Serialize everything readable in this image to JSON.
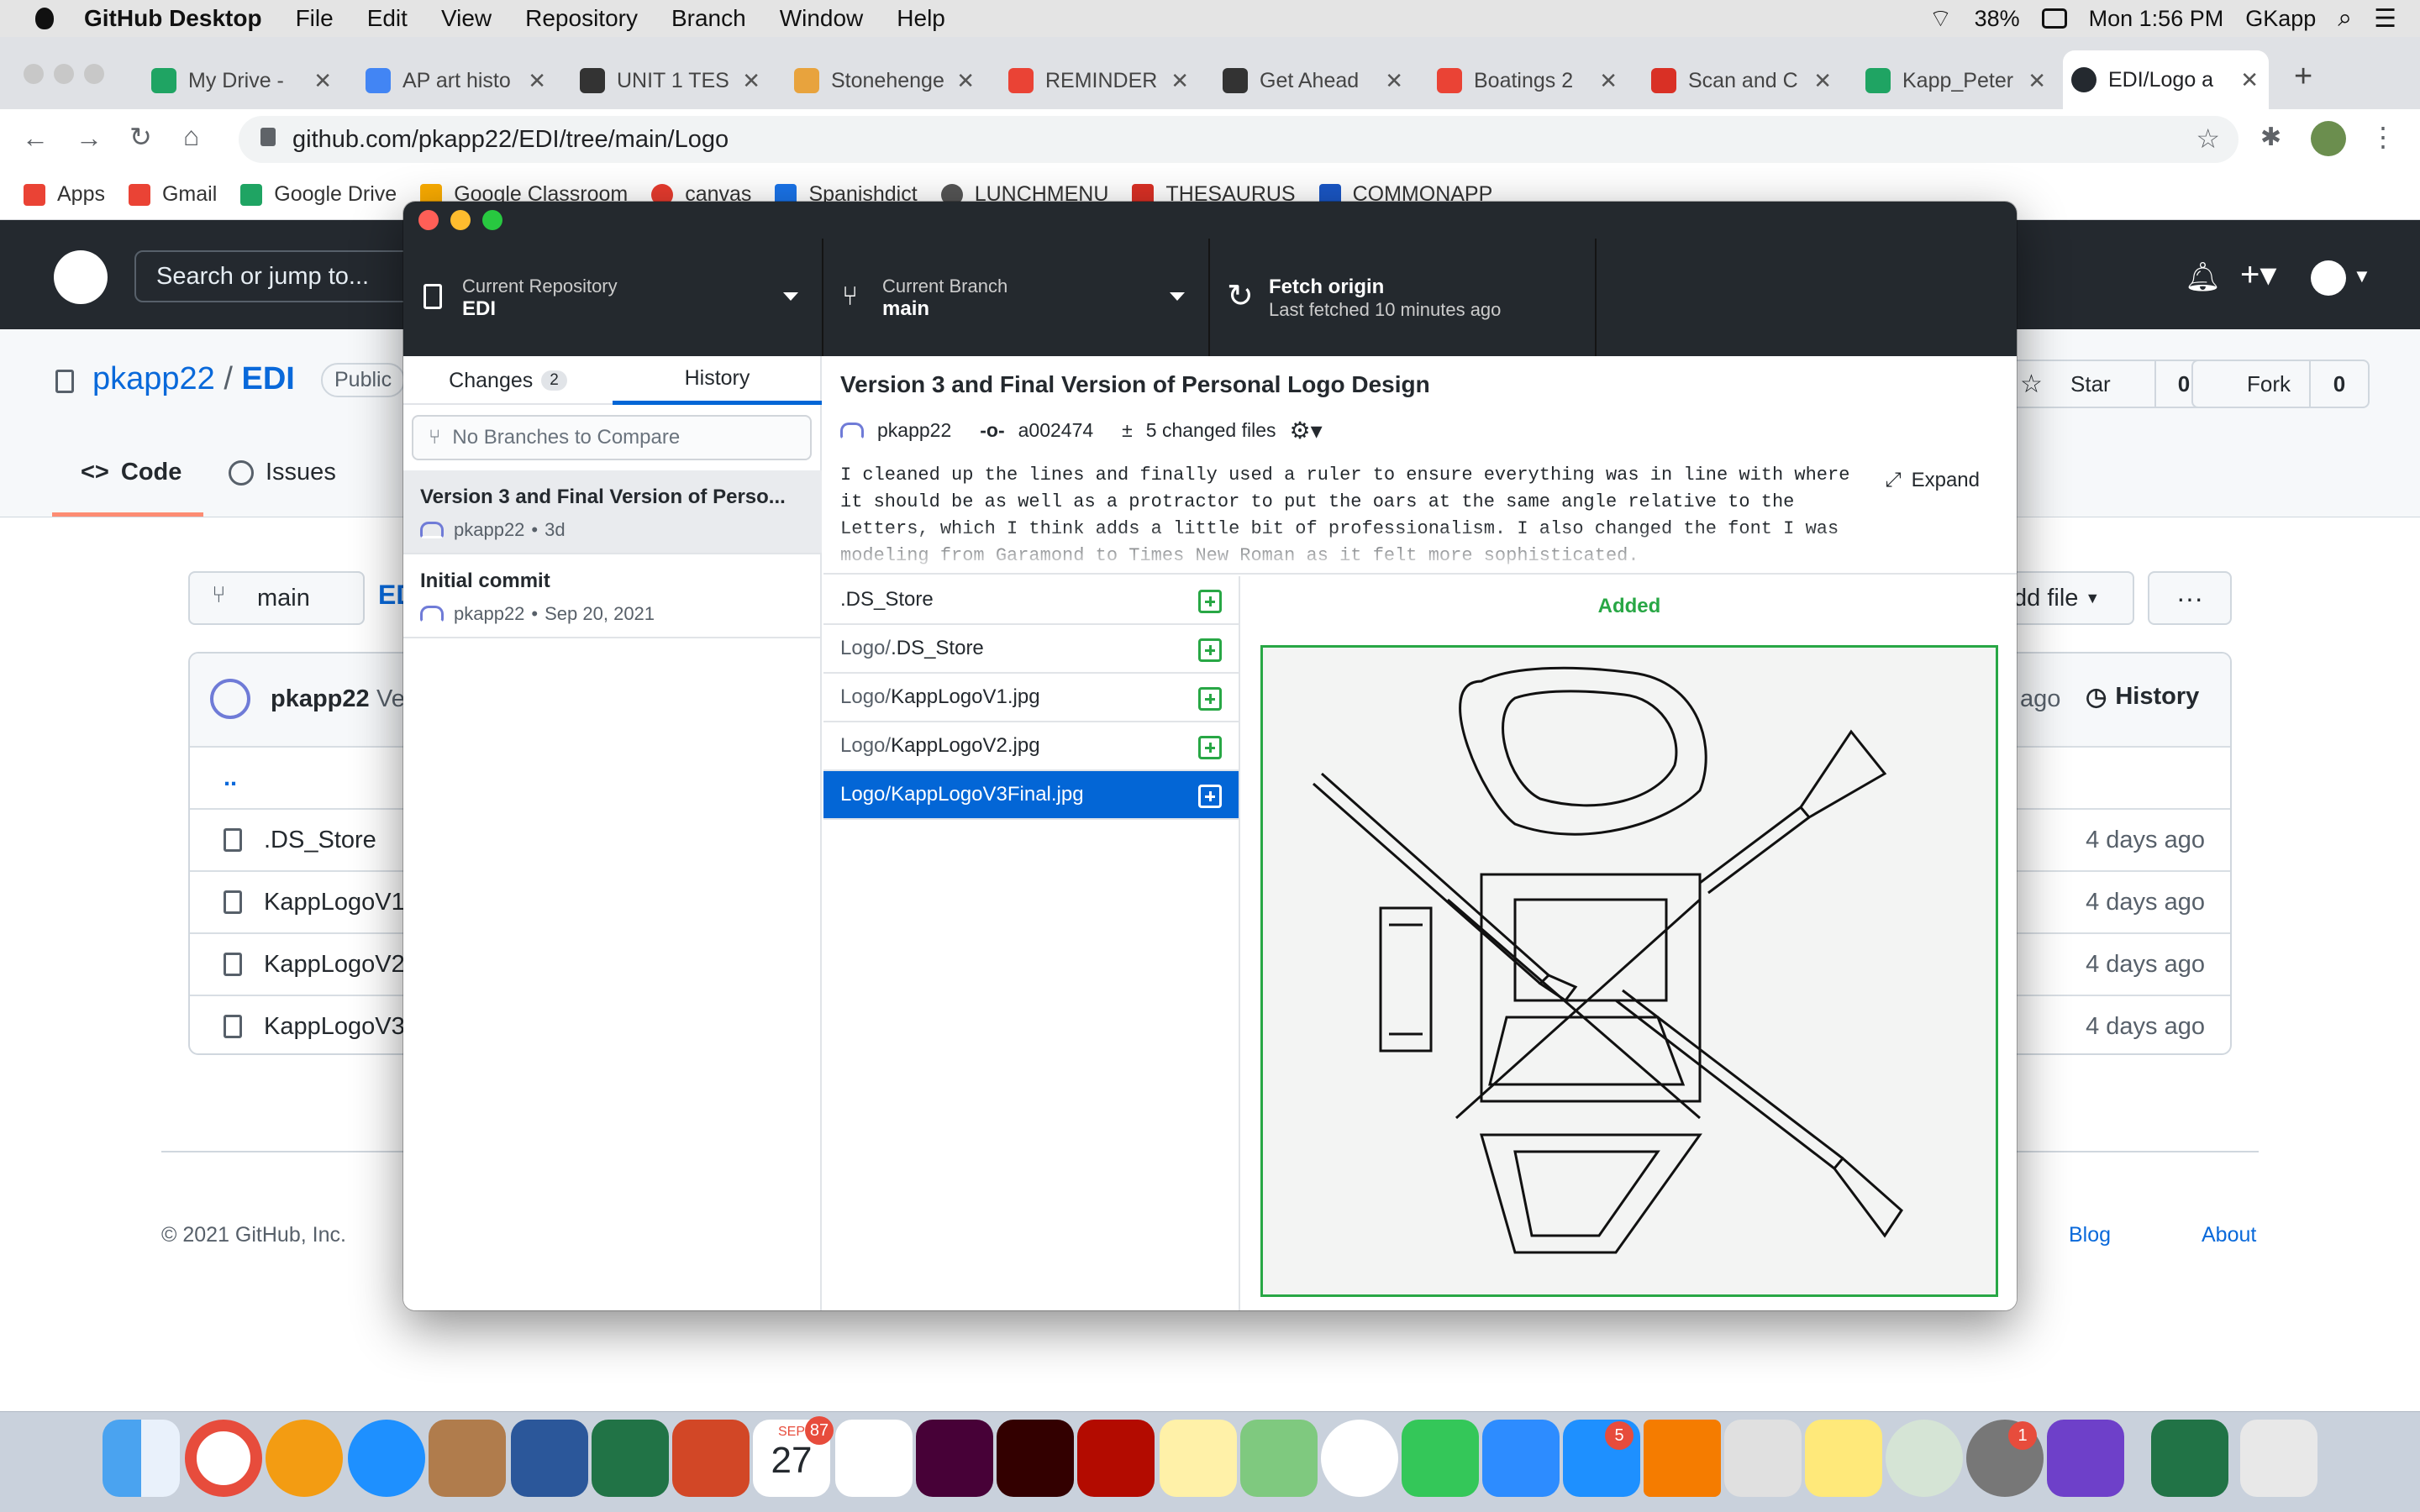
{
  "menubar": {
    "app_name": "GitHub Desktop",
    "items": [
      "File",
      "Edit",
      "View",
      "Repository",
      "Branch",
      "Window",
      "Help"
    ],
    "battery": "38%",
    "clock": "Mon 1:56 PM",
    "user": "GKapp"
  },
  "browser": {
    "tabs": [
      {
        "label": "My Drive - ",
        "icon": "google-drive-icon",
        "color": "#1fa463"
      },
      {
        "label": "AP art histo",
        "icon": "docs-icon",
        "color": "#4285f4"
      },
      {
        "label": "UNIT 1 TES",
        "icon": "classroom-icon",
        "color": "#333333"
      },
      {
        "label": "Stonehenge",
        "icon": "history-icon",
        "color": "#e8a33d"
      },
      {
        "label": "REMINDER",
        "icon": "gmail-icon",
        "color": "#ea4335"
      },
      {
        "label": "Get Ahead",
        "icon": "shield-icon",
        "color": "#333333"
      },
      {
        "label": "Boatings 2",
        "icon": "gmail-icon",
        "color": "#ea4335"
      },
      {
        "label": "Scan and C",
        "icon": "scan-icon",
        "color": "#d93025"
      },
      {
        "label": "Kapp_Peter",
        "icon": "google-drive-icon",
        "color": "#1fa463"
      },
      {
        "label": "EDI/Logo a",
        "icon": "github-icon",
        "color": "#24292f"
      }
    ],
    "url": "github.com/pkapp22/EDI/tree/main/Logo",
    "bookmarks": [
      {
        "label": "Apps",
        "color": "#ea4335"
      },
      {
        "label": "Gmail",
        "color": "#ea4335"
      },
      {
        "label": "Google Drive",
        "color": "#1fa463"
      },
      {
        "label": "Google Classroom",
        "color": "#f9ab00"
      },
      {
        "label": "canvas",
        "color": "#e63b2e"
      },
      {
        "label": "Spanishdict",
        "color": "#1a73e8"
      },
      {
        "label": "LUNCHMENU",
        "color": "#555555"
      },
      {
        "label": "THESAURUS",
        "color": "#d93025"
      },
      {
        "label": "COMMONAPP",
        "color": "#1a56c4"
      }
    ]
  },
  "github_page": {
    "search_placeholder": "Search or jump to...",
    "owner": "pkapp22",
    "separator": "/",
    "repo": "EDI",
    "visibility": "Public",
    "star_label": "Star",
    "star_count": "0",
    "fork_label": "Fork",
    "fork_count": "0",
    "nav_code": "Code",
    "nav_issues": "Issues",
    "branch": "main",
    "repo_crumb": "ED",
    "add_file": "dd file",
    "commit_user": "pkapp22",
    "commit_msg_partial": "Ve",
    "commit_age": "ago",
    "history": "History",
    "parent_dir": "..",
    "files": [
      {
        "name": ".DS_Store",
        "date": "4 days ago"
      },
      {
        "name": "KappLogoV1",
        "date": "4 days ago"
      },
      {
        "name": "KappLogoV2",
        "date": "4 days ago"
      },
      {
        "name": "KappLogoV3",
        "date": "4 days ago"
      }
    ],
    "footer_copy": "© 2021 GitHub, Inc.",
    "footer_blog": "Blog",
    "footer_about": "About"
  },
  "desktop": {
    "repo_title": "Current Repository",
    "repo_value": "EDI",
    "branch_title": "Current Branch",
    "branch_value": "main",
    "fetch_title": "Fetch origin",
    "fetch_sub": "Last fetched 10 minutes ago",
    "tab_changes": "Changes",
    "changes_count": "2",
    "tab_history": "History",
    "compare_placeholder": "No Branches to Compare",
    "commits": [
      {
        "message": "Version 3 and Final Version of Perso...",
        "author": "pkapp22",
        "when": "3d"
      },
      {
        "message": "Initial commit",
        "author": "pkapp22",
        "when": "Sep 20, 2021"
      }
    ],
    "commit_title": "Version 3 and Final Version of Personal Logo Design",
    "commit_author": "pkapp22",
    "commit_sha": "a002474",
    "changed_files": "5 changed files",
    "description": "I cleaned up the lines and finally used a ruler to ensure everything was in line with where it should be as well as a protractor to put the oars at the same angle relative to the Letters, which I think adds a little bit of professionalism. I also changed the font I was modeling from Garamond to Times New Roman as it felt more sophisticated.",
    "expand": "Expand",
    "files": [
      {
        "dir": "",
        "name": ".DS_Store"
      },
      {
        "dir": "Logo/",
        "name": ".DS_Store"
      },
      {
        "dir": "Logo/",
        "name": "KappLogoV1.jpg"
      },
      {
        "dir": "Logo/",
        "name": "KappLogoV2.jpg"
      },
      {
        "dir": "Logo/",
        "name": "KappLogoV3Final.jpg"
      }
    ],
    "diff_status": "Added"
  },
  "dock": {
    "calendar_month": "SEP",
    "calendar_day": "27",
    "calendar_badge": "87",
    "appstore_badge": "5",
    "settings_badge": "1"
  },
  "colors": {
    "accent": "#0366d6",
    "added": "#28a745",
    "header": "#24292e"
  }
}
